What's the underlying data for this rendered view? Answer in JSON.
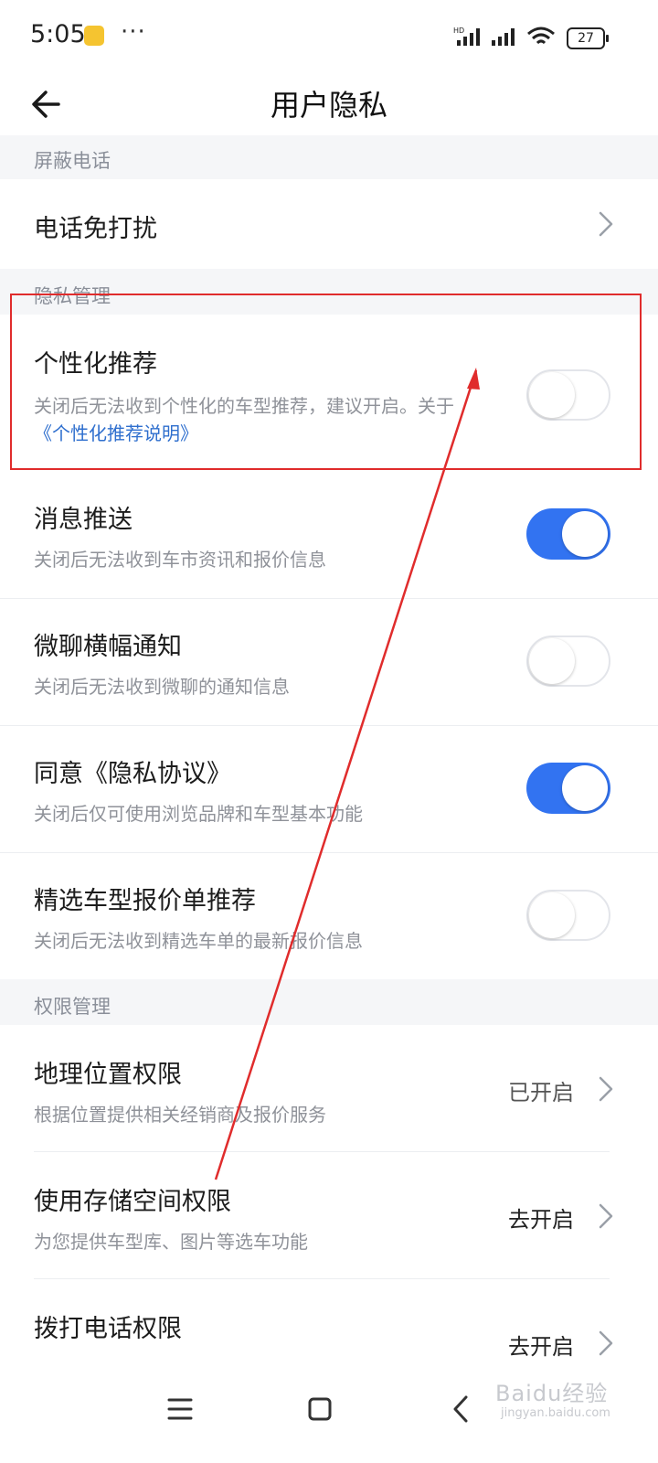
{
  "status_bar": {
    "time": "5:05",
    "dots": "···",
    "battery": "27"
  },
  "header": {
    "title": "用户隐私"
  },
  "sections": {
    "block_calls": "屏蔽电话",
    "privacy": "隐私管理",
    "permissions": "权限管理"
  },
  "rows": {
    "dnd": {
      "label": "电话免打扰"
    },
    "personalized": {
      "label": "个性化推荐",
      "desc": "关闭后无法收到个性化的车型推荐，建议开启。关于",
      "link": "《个性化推荐说明》",
      "enabled": false
    },
    "push": {
      "label": "消息推送",
      "desc": "关闭后无法收到车市资讯和报价信息",
      "enabled": true
    },
    "chat_banner": {
      "label": "微聊横幅通知",
      "desc": "关闭后无法收到微聊的通知信息",
      "enabled": false
    },
    "agree_privacy": {
      "label": "同意《隐私协议》",
      "desc": "关闭后仅可使用浏览品牌和车型基本功能",
      "enabled": true
    },
    "quote_recommend": {
      "label": "精选车型报价单推荐",
      "desc": "关闭后无法收到精选车单的最新报价信息",
      "enabled": false
    },
    "location": {
      "label": "地理位置权限",
      "desc": "根据位置提供相关经销商及报价服务",
      "value": "已开启"
    },
    "storage": {
      "label": "使用存储空间权限",
      "desc": "为您提供车型库、图片等选车功能",
      "value": "去开启"
    },
    "phone": {
      "label": "拨打电话权限",
      "value": "去开启"
    }
  },
  "watermark": {
    "text": "Baidu经验",
    "sub": "jingyan.baidu.com"
  },
  "colors": {
    "accent": "#3273f1",
    "annotation": "#e02c2c",
    "link": "#2f6fce"
  },
  "icons": [
    "back-arrow-icon",
    "chevron-right-icon",
    "menu-icon",
    "home-icon",
    "back-nav-icon"
  ]
}
